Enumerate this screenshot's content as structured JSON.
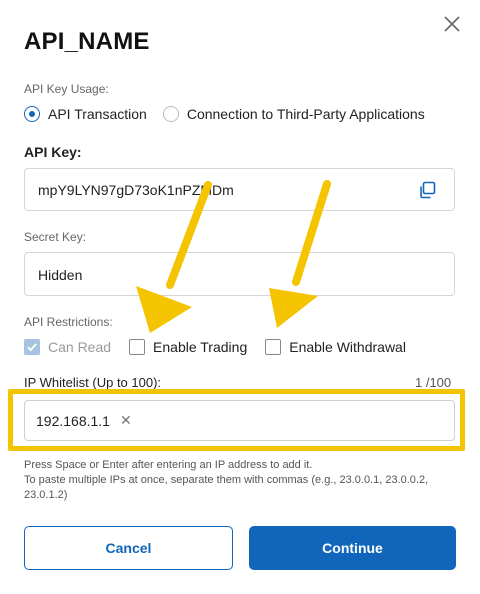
{
  "dialog": {
    "title": "API_NAME"
  },
  "usage": {
    "label": "API Key Usage:",
    "options": [
      {
        "label": "API Transaction",
        "selected": true
      },
      {
        "label": "Connection to Third-Party Applications",
        "selected": false
      }
    ]
  },
  "api_key": {
    "label": "API Key:",
    "value": "mpY9LYN97gD73oK1nPZMDm",
    "copy_icon": "copy-icon"
  },
  "secret_key": {
    "label": "Secret Key:",
    "value": "Hidden"
  },
  "restrictions": {
    "label": "API Restrictions:",
    "items": [
      {
        "label": "Can Read",
        "checked": true,
        "disabled": true
      },
      {
        "label": "Enable Trading",
        "checked": false,
        "disabled": false
      },
      {
        "label": "Enable Withdrawal",
        "checked": false,
        "disabled": false
      }
    ]
  },
  "whitelist": {
    "label": "IP Whitelist (Up to 100):",
    "count": "1 /100",
    "ips": [
      "192.168.1.1"
    ],
    "help_line1": "Press Space or Enter after entering an IP address to add it.",
    "help_line2": "To paste multiple IPs at once, separate them with commas (e.g., 23.0.0.1, 23.0.0.2, 23.0.1.2)"
  },
  "buttons": {
    "cancel": "Cancel",
    "continue": "Continue"
  },
  "colors": {
    "primary": "#1166bb",
    "highlight": "#f5c400",
    "annotation_arrow": "#f5c400"
  }
}
